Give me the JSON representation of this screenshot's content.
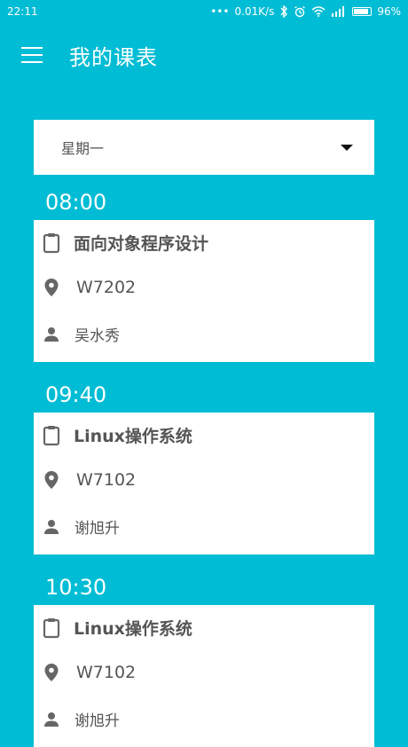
{
  "status_bar": {
    "time": "22:11",
    "speed": "0.01K/s",
    "battery": "96%"
  },
  "app_bar": {
    "title": "我的课表",
    "menu_icon": "menu-icon"
  },
  "day_selector": {
    "selected": "星期一",
    "icon": "dropdown-arrow-icon"
  },
  "schedule": [
    {
      "time": "08:00",
      "course": "面向对象程序设计",
      "room": "W7202",
      "teacher": "吴水秀"
    },
    {
      "time": "09:40",
      "course": "Linux操作系统",
      "room": "W7102",
      "teacher": "谢旭升"
    },
    {
      "time": "10:30",
      "course": "Linux操作系统",
      "room": "W7102",
      "teacher": "谢旭升"
    }
  ],
  "colors": {
    "background": "#00BCD4",
    "card": "#FFFFFF",
    "text": "#555555",
    "icon": "#666666"
  }
}
